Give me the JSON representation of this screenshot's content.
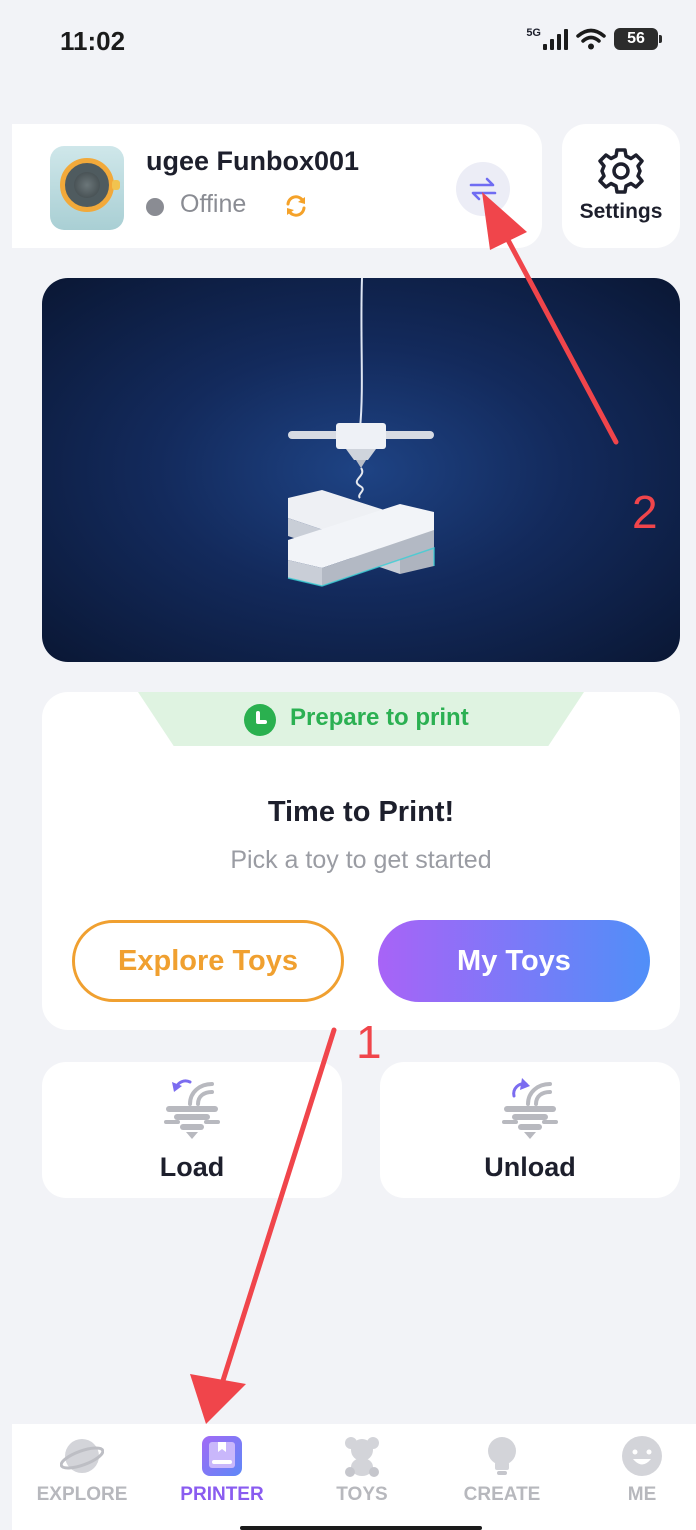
{
  "status_bar": {
    "time": "11:02",
    "network": "5G",
    "battery": "56"
  },
  "device": {
    "name": "ugee Funbox001",
    "status": "Offine",
    "status_color": "#8a8c93"
  },
  "settings": {
    "label": "Settings"
  },
  "print_card": {
    "badge": "Prepare to print",
    "title": "Time to Print!",
    "subtitle": "Pick a toy to get started",
    "explore_button": "Explore Toys",
    "mytoys_button": "My Toys"
  },
  "actions": {
    "load": "Load",
    "unload": "Unload"
  },
  "tabbar": {
    "items": [
      {
        "label": "EXPLORE",
        "icon": "planet-icon",
        "active": false
      },
      {
        "label": "PRINTER",
        "icon": "printer-icon",
        "active": true
      },
      {
        "label": "TOYS",
        "icon": "teddy-bear-icon",
        "active": false
      },
      {
        "label": "CREATE",
        "icon": "lightbulb-icon",
        "active": false
      },
      {
        "label": "ME",
        "icon": "smiley-face-icon",
        "active": false
      }
    ]
  },
  "annotations": {
    "label_1": "1",
    "label_2": "2"
  },
  "colors": {
    "accent_orange": "#f0a030",
    "accent_purple": "#8a5cf0",
    "accent_green": "#2bb052",
    "annotation_red": "#f0454b"
  }
}
